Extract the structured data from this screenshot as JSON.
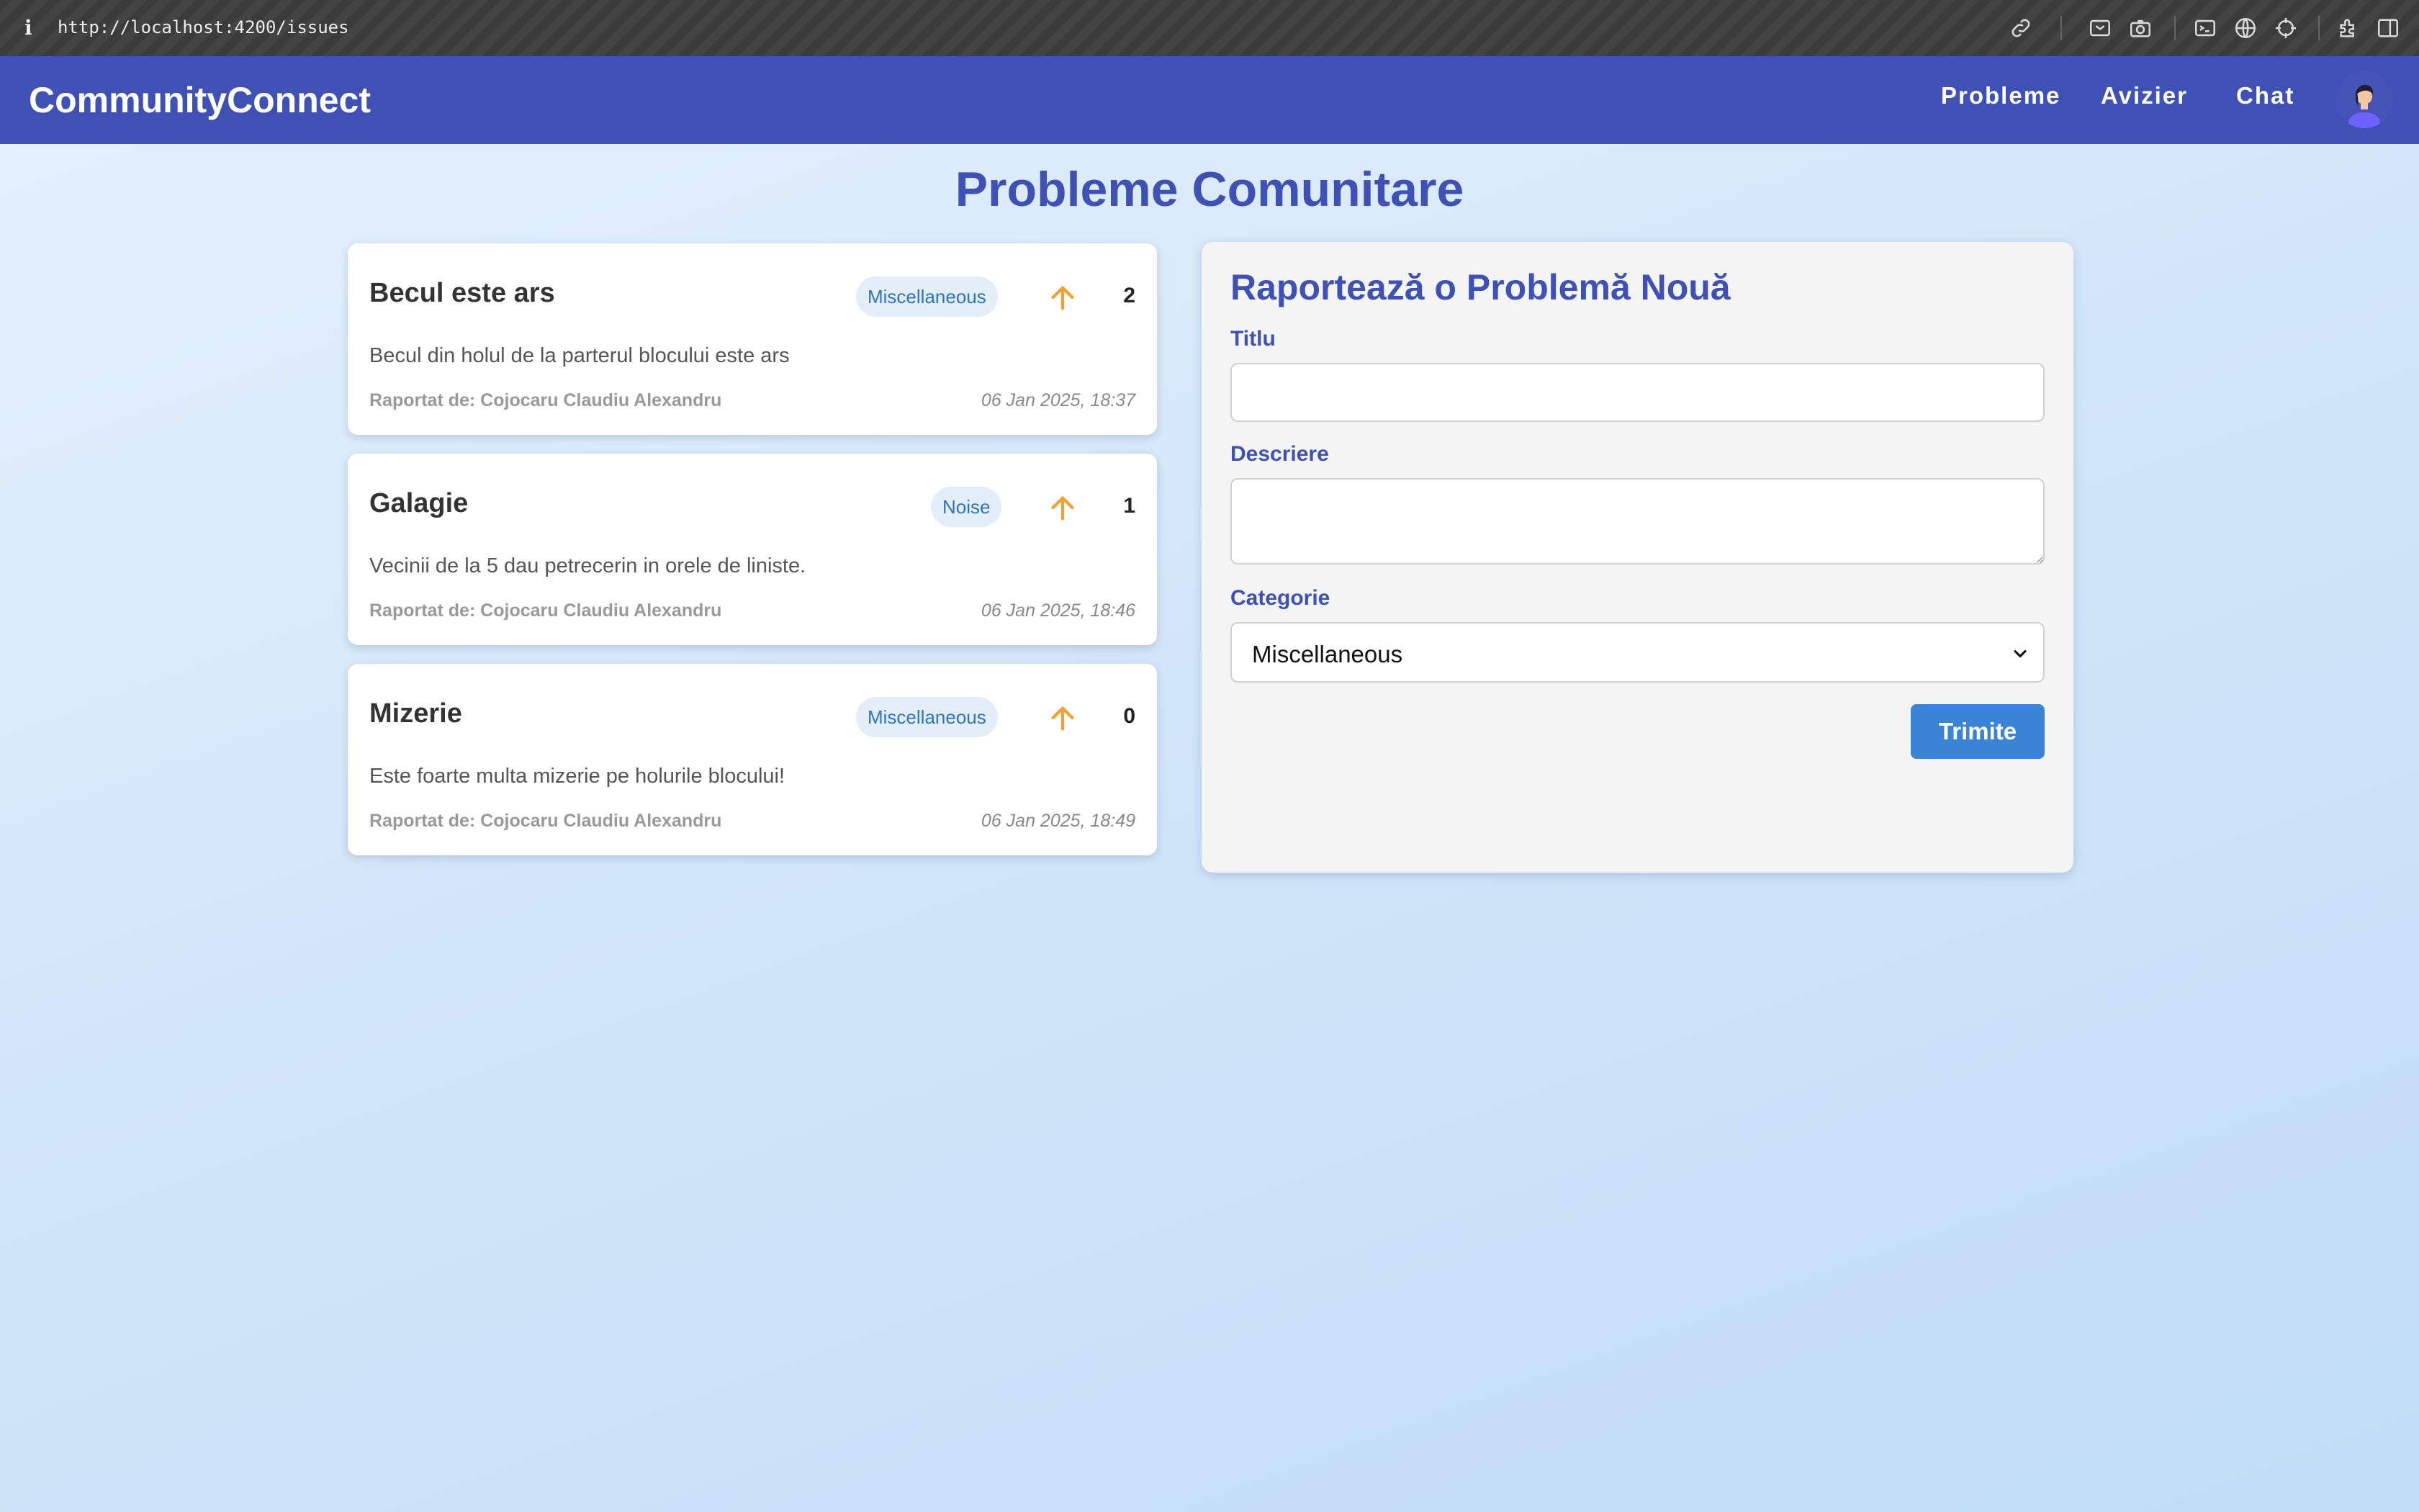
{
  "browser": {
    "info_glyph": "i",
    "url": "http://localhost:4200/issues",
    "toolbar_icons": [
      "link-icon",
      "screenshot-area-icon",
      "camera-icon",
      "terminal-icon",
      "globe-icon",
      "crosshair-icon",
      "extensions-icon",
      "sidebar-icon"
    ]
  },
  "header": {
    "brand": "CommunityConnect",
    "nav": [
      {
        "label": "Probleme"
      },
      {
        "label": "Avizier"
      },
      {
        "label": "Chat"
      }
    ],
    "colors": {
      "primary": "#3f51b5"
    }
  },
  "main": {
    "title": "Probleme Comunitare",
    "issues": [
      {
        "title": "Becul este ars",
        "category": "Miscellaneous",
        "votes": "2",
        "description": "Becul din holul de la parterul blocului este ars",
        "author": "Raportat de: Cojocaru Claudiu Alexandru",
        "date": "06 Jan 2025, 18:37"
      },
      {
        "title": "Galagie",
        "category": "Noise",
        "votes": "1",
        "description": "Vecinii de la 5 dau petrecerin in orele de liniste.",
        "author": "Raportat de: Cojocaru Claudiu Alexandru",
        "date": "06 Jan 2025, 18:46"
      },
      {
        "title": "Mizerie",
        "category": "Miscellaneous",
        "votes": "0",
        "description": "Este foarte multa mizerie pe holurile blocului!",
        "author": "Raportat de: Cojocaru Claudiu Alexandru",
        "date": "06 Jan 2025, 18:49"
      }
    ]
  },
  "form": {
    "title": "Raportează o Problemă Nouă",
    "title_label": "Titlu",
    "title_value": "",
    "description_label": "Descriere",
    "description_value": "",
    "category_label": "Categorie",
    "category_selected": "Miscellaneous",
    "submit_label": "Trimite"
  }
}
